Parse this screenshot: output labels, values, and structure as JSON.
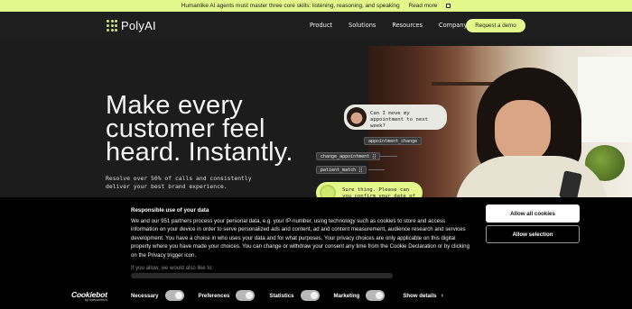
{
  "announcement": {
    "text": "Humanlike AI agents must master three core skills: listening, reasoning, and speaking",
    "link": "Read more"
  },
  "nav": {
    "logo": "PolyAI",
    "links": [
      "Product",
      "Solutions",
      "Resources",
      "Company"
    ],
    "cta": "Request a demo"
  },
  "hero": {
    "title": "Make every customer feel heard. Instantly.",
    "subtitle": "Resolve over 50% of calls and consistently deliver your best brand experience."
  },
  "illustration": {
    "question": "Can I move my appointment to next week?",
    "tags": [
      "appointment_change",
      "change_appointment",
      "patient_match"
    ],
    "answer": "Sure thing. Please can you confirm your date of birth?"
  },
  "consent": {
    "title": "Responsible use of your data",
    "body": "We and our 951 partners process your personal data, e.g. your IP-number, using technology such as cookies to store and access information on your device in order to serve personalized ads and content, ad and content measurement, audience research and services development. You have a choice in who uses your data and for what purposes. Your privacy choices are only applicable on this digital property where you have made your choices. You can change or withdraw your consent any time from the Cookie Declaration or by clicking on the Privacy trigger icon.",
    "more": "If you allow, we would also like to:",
    "allow_all": "Allow all cookies",
    "allow_selection": "Allow selection",
    "brand": "Cookiebot",
    "brand_sub": "by Usercentrics",
    "toggles": [
      "Necessary",
      "Preferences",
      "Statistics",
      "Marketing"
    ],
    "show_details": "Show details"
  },
  "colors": {
    "accent": "#e4f78a",
    "background": "#1c1c1c",
    "consent_bg": "#000000"
  }
}
